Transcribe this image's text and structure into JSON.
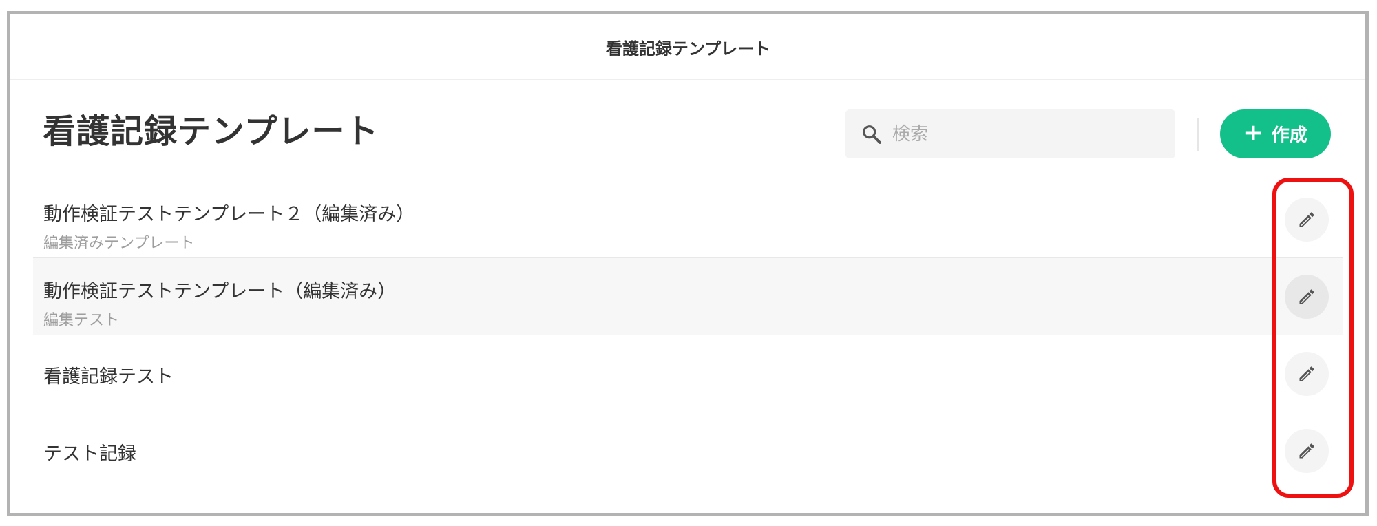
{
  "header": {
    "title": "看護記録テンプレート"
  },
  "page": {
    "title": "看護記録テンプレート"
  },
  "search": {
    "placeholder": "検索",
    "icon": "search-icon"
  },
  "create_button": {
    "icon": "plus-icon",
    "label": "作成",
    "color": "#14c08a"
  },
  "templates": [
    {
      "title": "動作検証テストテンプレート２（編集済み）",
      "subtitle": "編集済みテンプレート",
      "action_icon": "pencil-icon"
    },
    {
      "title": "動作検証テストテンプレート（編集済み）",
      "subtitle": "編集テスト",
      "action_icon": "pencil-icon"
    },
    {
      "title": "看護記録テスト",
      "subtitle": "",
      "action_icon": "pencil-icon"
    },
    {
      "title": "テスト記録",
      "subtitle": "",
      "action_icon": "pencil-icon"
    }
  ],
  "annotation": {
    "color": "#ee1111"
  }
}
